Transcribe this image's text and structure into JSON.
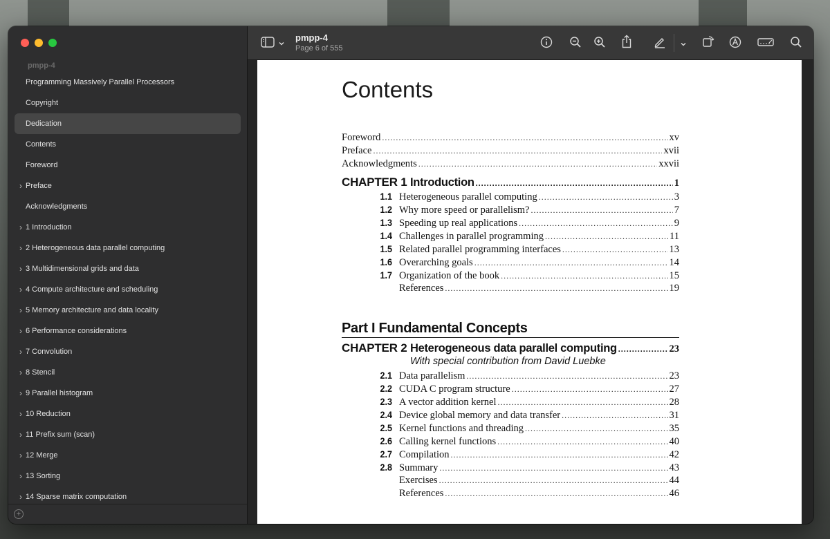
{
  "sidebar": {
    "doc_title": "pmpp-4",
    "items": [
      {
        "label": "Programming Massively Parallel Processors",
        "expandable": false,
        "selected": false
      },
      {
        "label": "Copyright",
        "expandable": false,
        "selected": false
      },
      {
        "label": "Dedication",
        "expandable": false,
        "selected": true
      },
      {
        "label": "Contents",
        "expandable": false,
        "selected": false
      },
      {
        "label": "Foreword",
        "expandable": false,
        "selected": false
      },
      {
        "label": "Preface",
        "expandable": true,
        "selected": false
      },
      {
        "label": "Acknowledgments",
        "expandable": false,
        "selected": false
      },
      {
        "label": "1 Introduction",
        "expandable": true,
        "selected": false
      },
      {
        "label": "2 Heterogeneous data parallel computing",
        "expandable": true,
        "selected": false
      },
      {
        "label": "3 Multidimensional grids and data",
        "expandable": true,
        "selected": false
      },
      {
        "label": "4 Compute architecture and scheduling",
        "expandable": true,
        "selected": false
      },
      {
        "label": "5 Memory architecture and data locality",
        "expandable": true,
        "selected": false
      },
      {
        "label": "6 Performance considerations",
        "expandable": true,
        "selected": false
      },
      {
        "label": "7 Convolution",
        "expandable": true,
        "selected": false
      },
      {
        "label": "8 Stencil",
        "expandable": true,
        "selected": false
      },
      {
        "label": "9 Parallel histogram",
        "expandable": true,
        "selected": false
      },
      {
        "label": "10 Reduction",
        "expandable": true,
        "selected": false
      },
      {
        "label": "11 Prefix sum (scan)",
        "expandable": true,
        "selected": false
      },
      {
        "label": "12 Merge",
        "expandable": true,
        "selected": false
      },
      {
        "label": "13 Sorting",
        "expandable": true,
        "selected": false
      },
      {
        "label": "14 Sparse matrix computation",
        "expandable": true,
        "selected": false
      }
    ]
  },
  "toolbar": {
    "title": "pmpp-4",
    "subtitle": "Page 6 of 555",
    "icons": [
      "sidebar-toggle-icon",
      "chevron-down-icon",
      "info-icon",
      "zoom-out-icon",
      "zoom-in-icon",
      "share-icon",
      "highlight-pen-icon",
      "chevron-down-icon",
      "rotate-icon",
      "markup-icon",
      "form-fill-icon",
      "search-icon"
    ]
  },
  "page": {
    "heading": "Contents",
    "front_matter": [
      {
        "title": "Foreword",
        "page": "xv"
      },
      {
        "title": "Preface",
        "page": "xvii"
      },
      {
        "title": "Acknowledgments",
        "page": "xxvii"
      }
    ],
    "chapter1": {
      "label": "CHAPTER 1",
      "title": "Introduction",
      "page": "1",
      "sections": [
        {
          "num": "1.1",
          "title": "Heterogeneous parallel computing",
          "page": "3"
        },
        {
          "num": "1.2",
          "title": "Why more speed or parallelism?",
          "page": "7"
        },
        {
          "num": "1.3",
          "title": "Speeding up real applications",
          "page": "9"
        },
        {
          "num": "1.4",
          "title": "Challenges in parallel programming",
          "page": "11"
        },
        {
          "num": "1.5",
          "title": "Related parallel programming interfaces",
          "page": "13"
        },
        {
          "num": "1.6",
          "title": "Overarching goals",
          "page": "14"
        },
        {
          "num": "1.7",
          "title": "Organization of the book",
          "page": "15"
        },
        {
          "num": "",
          "title": "References",
          "page": "19"
        }
      ]
    },
    "part1": {
      "title": "Part I  Fundamental Concepts"
    },
    "chapter2": {
      "label": "CHAPTER 2",
      "title": "Heterogeneous data parallel computing",
      "page": "23",
      "contribution": "With special contribution from David Luebke",
      "sections": [
        {
          "num": "2.1",
          "title": "Data parallelism",
          "page": "23"
        },
        {
          "num": "2.2",
          "title": "CUDA C program structure",
          "page": "27"
        },
        {
          "num": "2.3",
          "title": "A vector addition kernel",
          "page": "28"
        },
        {
          "num": "2.4",
          "title": "Device global memory and data transfer",
          "page": "31"
        },
        {
          "num": "2.5",
          "title": "Kernel functions and threading",
          "page": "35"
        },
        {
          "num": "2.6",
          "title": "Calling kernel functions",
          "page": "40"
        },
        {
          "num": "2.7",
          "title": "Compilation",
          "page": "42"
        },
        {
          "num": "2.8",
          "title": "Summary",
          "page": "43"
        },
        {
          "num": "",
          "title": "Exercises",
          "page": "44"
        },
        {
          "num": "",
          "title": "References",
          "page": "46"
        }
      ]
    }
  }
}
